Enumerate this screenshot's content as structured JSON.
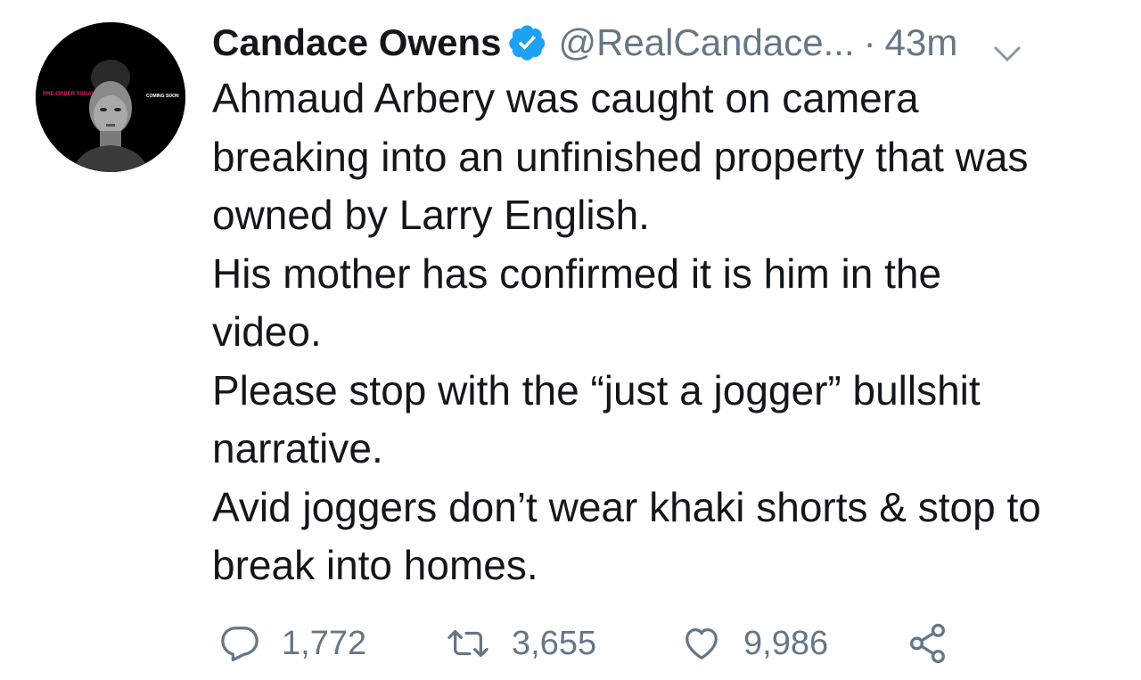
{
  "tweet": {
    "author": {
      "display_name": "Candace Owens",
      "handle": "@RealCandace...",
      "avatar_text_left": "PRE-ORDER TODAY",
      "avatar_text_right": "COMING SOON"
    },
    "separator": "·",
    "timestamp": "43m",
    "lines": [
      "Ahmaud Arbery was caught on camera",
      "breaking into an unfinished property that was",
      "owned by Larry English.",
      "His mother has confirmed it is him in the",
      "video.",
      "Please stop with the “just a jogger” bullshit",
      "narrative.",
      "Avid joggers don’t wear khaki shorts & stop to",
      "break into homes."
    ],
    "actions": {
      "reply_count": "1,772",
      "retweet_count": "3,655",
      "like_count": "9,986"
    }
  },
  "colors": {
    "text": "#14171a",
    "secondary": "#657786",
    "verified": "#1da1f2",
    "avatar_bg": "#000000",
    "avatar_accent_left": "#e0245e"
  },
  "icons": [
    "verified-badge-icon",
    "chevron-down-icon",
    "reply-icon",
    "retweet-icon",
    "like-icon",
    "share-icon"
  ]
}
